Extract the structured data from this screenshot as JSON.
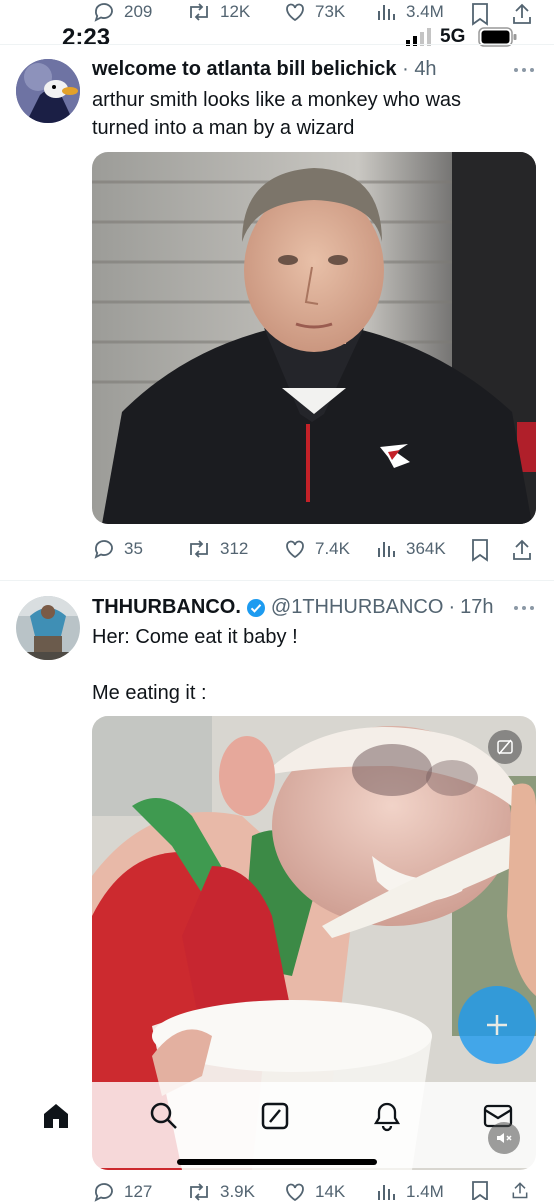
{
  "status_bar": {
    "time": "2:23",
    "network": "5G"
  },
  "top_actions": {
    "replies": "209",
    "reposts": "12K",
    "likes": "73K",
    "views": "3.4M"
  },
  "tweet1": {
    "name": "welcome to atlanta bill belichick",
    "time": "4h",
    "text": "arthur smith looks like a monkey who was turned into a man by a wizard",
    "replies": "35",
    "reposts": "312",
    "likes": "7.4K",
    "views": "364K"
  },
  "tweet2": {
    "name": "THHURBANCO.",
    "handle": "@1THHURBANCO",
    "time": "17h",
    "text_line1": "Her: Come eat it baby !",
    "text_line2": "Me eating it :",
    "replies": "127",
    "reposts": "3.9K",
    "likes": "14K",
    "views": "1.4M"
  },
  "colors": {
    "accent": "#1d9bf0",
    "fab": "#1d9bf0"
  },
  "icons": [
    "reply-icon",
    "repost-icon",
    "like-icon",
    "views-icon",
    "bookmark-icon",
    "share-icon",
    "more-icon",
    "verified-icon",
    "home-icon",
    "search-icon",
    "grok-icon",
    "notifications-icon",
    "messages-icon",
    "compose-icon",
    "mute-icon",
    "gif-alt-icon"
  ]
}
